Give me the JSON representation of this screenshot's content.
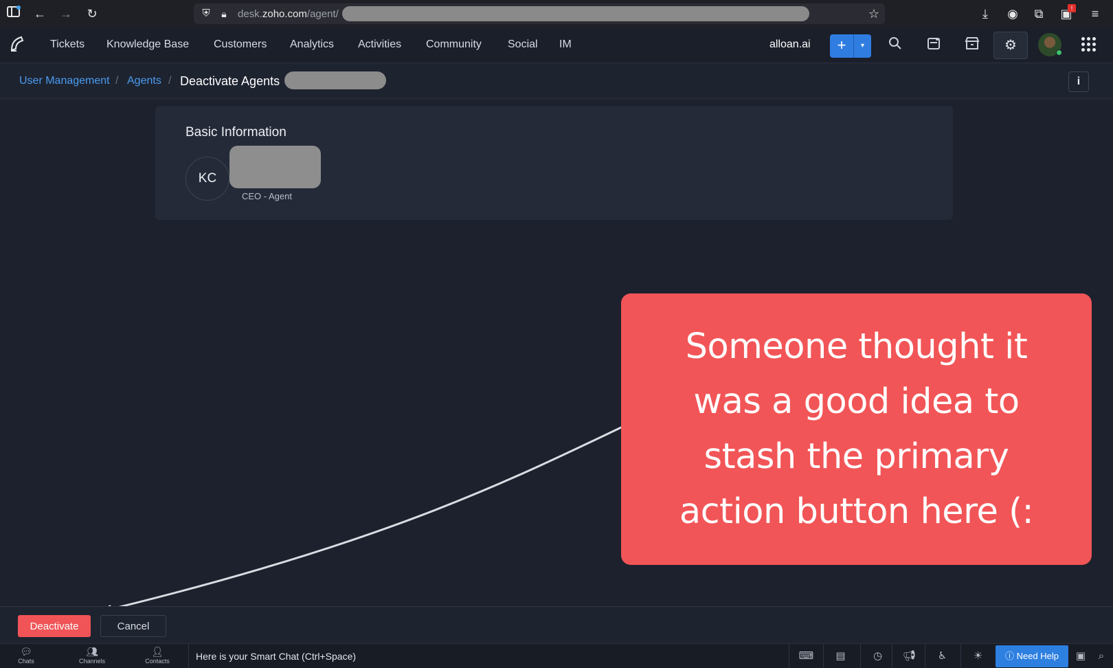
{
  "browser": {
    "url_host_prefix": "desk.",
    "url_host_main": "zoho.com",
    "url_path": "/agent/"
  },
  "nav": {
    "items": [
      "Tickets",
      "Knowledge Base",
      "Customers",
      "Analytics",
      "Activities",
      "Community",
      "Social",
      "IM"
    ],
    "org_name": "alloan.ai",
    "add_label": "+",
    "add_dropdown": "▾"
  },
  "breadcrumb": {
    "level1": "User Management",
    "level2": "Agents",
    "separator": "/",
    "current": "Deactivate Agents",
    "info_label": "i"
  },
  "card": {
    "title": "Basic Information",
    "avatar_initials": "KC",
    "role": "CEO - Agent"
  },
  "annotation": {
    "line1": "Someone thought it",
    "line2": "was a good idea to",
    "line3": "stash the primary",
    "line4": "action button here (:",
    "color": "#f25557"
  },
  "actions": {
    "deactivate_label": "Deactivate",
    "cancel_label": "Cancel"
  },
  "statusbar": {
    "tabs": [
      "Chats",
      "Channels",
      "Contacts"
    ],
    "smart_chat": "Here is your Smart Chat (Ctrl+Space)",
    "need_help": "Need Help"
  },
  "colors": {
    "accent": "#2f7de1",
    "danger": "#f05457",
    "link": "#4a9cf0"
  }
}
